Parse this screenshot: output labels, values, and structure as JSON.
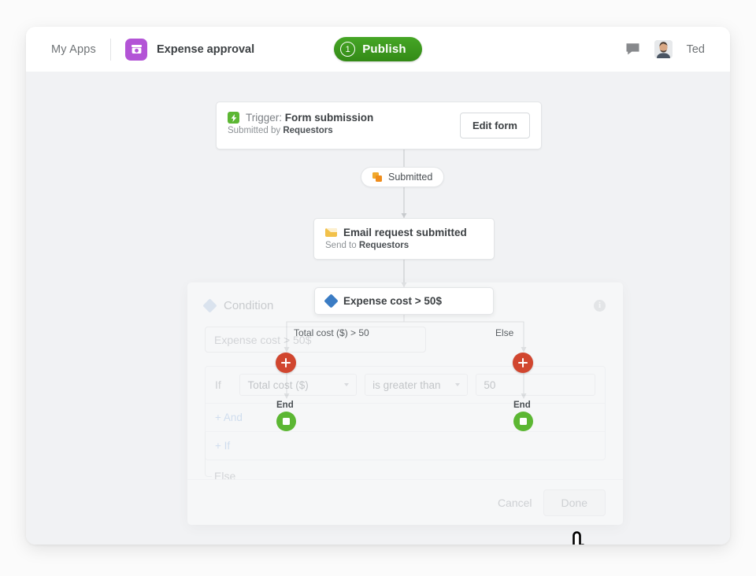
{
  "header": {
    "my_apps": "My Apps",
    "app_icon": "money-box-icon",
    "app_title": "Expense approval",
    "publish": {
      "count": "1",
      "label": "Publish"
    },
    "chat_icon": "chat-bubble-icon",
    "avatar_icon": "user-avatar",
    "user_name": "Ted",
    "accent_purple": "#b354d6",
    "accent_green": "#3d9d1f"
  },
  "flow": {
    "trigger": {
      "icon": "lightning-bolt-icon",
      "prefix": "Trigger: ",
      "title": "Form submission",
      "sub_prefix": "Submitted by ",
      "sub_value": "Requestors",
      "edit_button": "Edit form"
    },
    "pill": {
      "icon": "copy-icon",
      "label": "Submitted"
    },
    "email": {
      "icon": "envelope-icon",
      "title": "Email request submitted",
      "sub_prefix": "Send to ",
      "sub_value": "Requestors"
    },
    "condition_node": {
      "icon": "diamond-icon",
      "label": "Expense cost > 50$"
    },
    "branch_true_label": "Total cost ($) > 50",
    "branch_false_label": "Else",
    "plus_icon": "plus-icon",
    "end_left": {
      "label": "End",
      "icon": "stop-square-icon"
    },
    "end_right": {
      "label": "End",
      "icon": "stop-square-icon"
    },
    "node_color_condition": "#3b7cc4",
    "node_color_plus": "#d1462f",
    "node_color_end": "#5cb733"
  },
  "dialog": {
    "icon": "diamond-icon",
    "title": "Condition",
    "info_icon": "info-icon",
    "info_glyph": "i",
    "name_value": "Expense cost > 50$",
    "rule": {
      "if_label": "If",
      "field": "Total cost ($)",
      "operator": "is greater than",
      "value": "50"
    },
    "add_and": "+ And",
    "add_if": "+ If",
    "else_label": "Else",
    "cancel": "Cancel",
    "done": "Done"
  },
  "cursor": {
    "icon": "pointing-hand-cursor"
  }
}
